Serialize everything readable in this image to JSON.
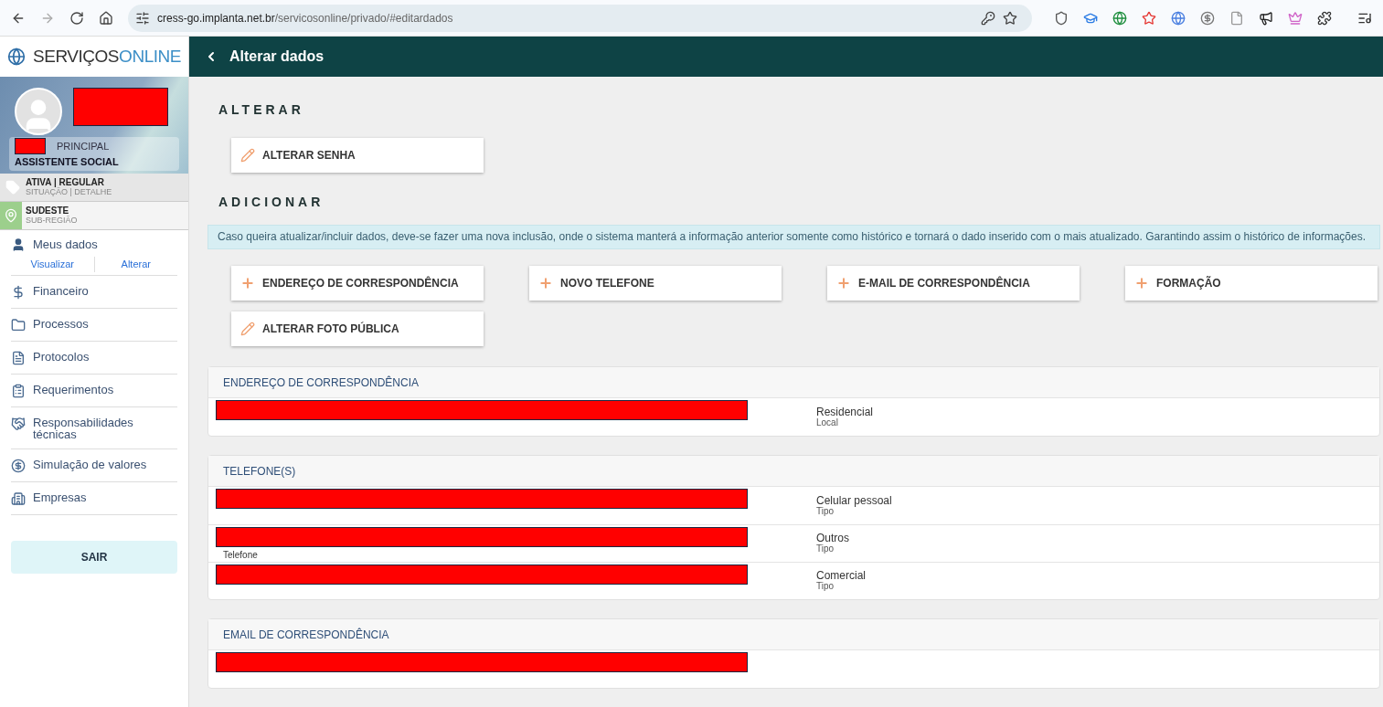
{
  "browser": {
    "url_host": "cress-go.implanta.net.br",
    "url_path": "/servicosonline/privado/#editardados"
  },
  "sidebar": {
    "logo": {
      "part1": "SERVIÇOS",
      "part2": "ONLINE"
    },
    "profile": {
      "category": "PRINCIPAL",
      "role": "ASSISTENTE SOCIAL"
    },
    "status": {
      "value": "ATIVA | REGULAR",
      "caption": "SITUAÇÃO | DETALHE"
    },
    "region": {
      "value": "SUDESTE",
      "caption": "SUB-REGIÃO"
    },
    "meus_dados": {
      "label": "Meus dados",
      "links": [
        "Visualizar",
        "Alterar"
      ]
    },
    "items": [
      {
        "kind": "money",
        "label": "Financeiro"
      },
      {
        "kind": "folder",
        "label": "Processos"
      },
      {
        "kind": "file",
        "label": "Protocolos"
      },
      {
        "kind": "clipboard",
        "label": "Requerimentos"
      },
      {
        "kind": "handshake",
        "label": "Responsabilidades técnicas"
      },
      {
        "kind": "coin",
        "label": "Simulação de valores"
      },
      {
        "kind": "building",
        "label": "Empresas"
      }
    ],
    "logout": "SAIR"
  },
  "header": {
    "title": "Alterar dados"
  },
  "alterar": {
    "heading": "ALTERAR",
    "buttons": [
      {
        "kind": "edit",
        "label": "ALTERAR SENHA"
      }
    ]
  },
  "adicionar": {
    "heading": "ADICIONAR",
    "info": "Caso queira atualizar/incluir dados, deve-se fazer uma nova inclusão, onde o sistema manterá a informação anterior somente como histórico e tornará o dado inserido com o mais atualizado. Garantindo assim o histórico de informações.",
    "buttons": [
      {
        "kind": "add",
        "label": "ENDEREÇO DE CORRESPONDÊNCIA"
      },
      {
        "kind": "add",
        "label": "NOVO TELEFONE"
      },
      {
        "kind": "add",
        "label": "E-MAIL DE CORRESPONDÊNCIA"
      },
      {
        "kind": "add",
        "label": "FORMAÇÃO"
      },
      {
        "kind": "edit",
        "label": "ALTERAR FOTO PÚBLICA"
      }
    ]
  },
  "cards": [
    {
      "title": "ENDEREÇO DE CORRESPONDÊNCIA",
      "rows": [
        {
          "type": "Residencial",
          "type_label": "Local"
        }
      ]
    },
    {
      "title": "TELEFONE(S)",
      "rows": [
        {
          "type": "Celular pessoal",
          "type_label": "Tipo"
        },
        {
          "field_label": "Telefone",
          "type": "Outros",
          "type_label": "Tipo"
        },
        {
          "type": "Comercial",
          "type_label": "Tipo"
        }
      ]
    },
    {
      "title": "EMAIL DE CORRESPONDÊNCIA",
      "rows": [
        {}
      ]
    }
  ]
}
